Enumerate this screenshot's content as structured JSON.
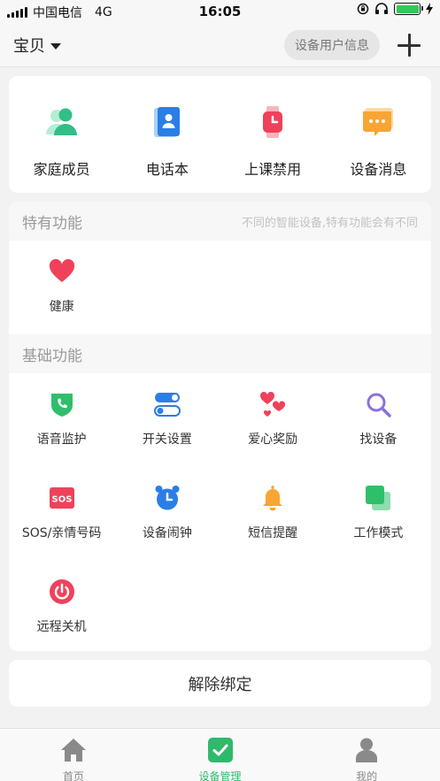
{
  "status_bar": {
    "carrier": "中国电信",
    "network": "4G",
    "time": "16:05"
  },
  "header": {
    "device_name": "宝贝",
    "info_button": "设备用户信息"
  },
  "top_actions": [
    {
      "label": "家庭成员",
      "icon": "family-member-icon"
    },
    {
      "label": "电话本",
      "icon": "phonebook-icon"
    },
    {
      "label": "上课禁用",
      "icon": "class-disable-watch-icon"
    },
    {
      "label": "设备消息",
      "icon": "device-message-icon"
    }
  ],
  "special_section": {
    "title": "特有功能",
    "note": "不同的智能设备,特有功能会有不同",
    "items": [
      {
        "label": "健康",
        "icon": "heart-icon"
      }
    ]
  },
  "basic_section": {
    "title": "基础功能",
    "items": [
      {
        "label": "语音监护",
        "icon": "voice-monitor-shield-icon"
      },
      {
        "label": "开关设置",
        "icon": "switch-toggle-icon"
      },
      {
        "label": "爱心奖励",
        "icon": "hearts-reward-icon"
      },
      {
        "label": "找设备",
        "icon": "search-icon"
      },
      {
        "label": "SOS/亲情号码",
        "icon": "sos-icon"
      },
      {
        "label": "设备闹钟",
        "icon": "alarm-clock-icon"
      },
      {
        "label": "短信提醒",
        "icon": "bell-icon"
      },
      {
        "label": "工作模式",
        "icon": "work-mode-icon"
      },
      {
        "label": "远程关机",
        "icon": "power-icon"
      }
    ]
  },
  "unbind_button": "解除绑定",
  "tabs": [
    {
      "label": "首页",
      "icon": "home-icon",
      "active": false
    },
    {
      "label": "设备管理",
      "icon": "device-manage-check-icon",
      "active": true
    },
    {
      "label": "我的",
      "icon": "profile-icon",
      "active": false
    }
  ],
  "colors": {
    "accent_green": "#2fb96b",
    "red": "#f0415a",
    "blue": "#2a7ee6",
    "orange": "#f8a532"
  }
}
